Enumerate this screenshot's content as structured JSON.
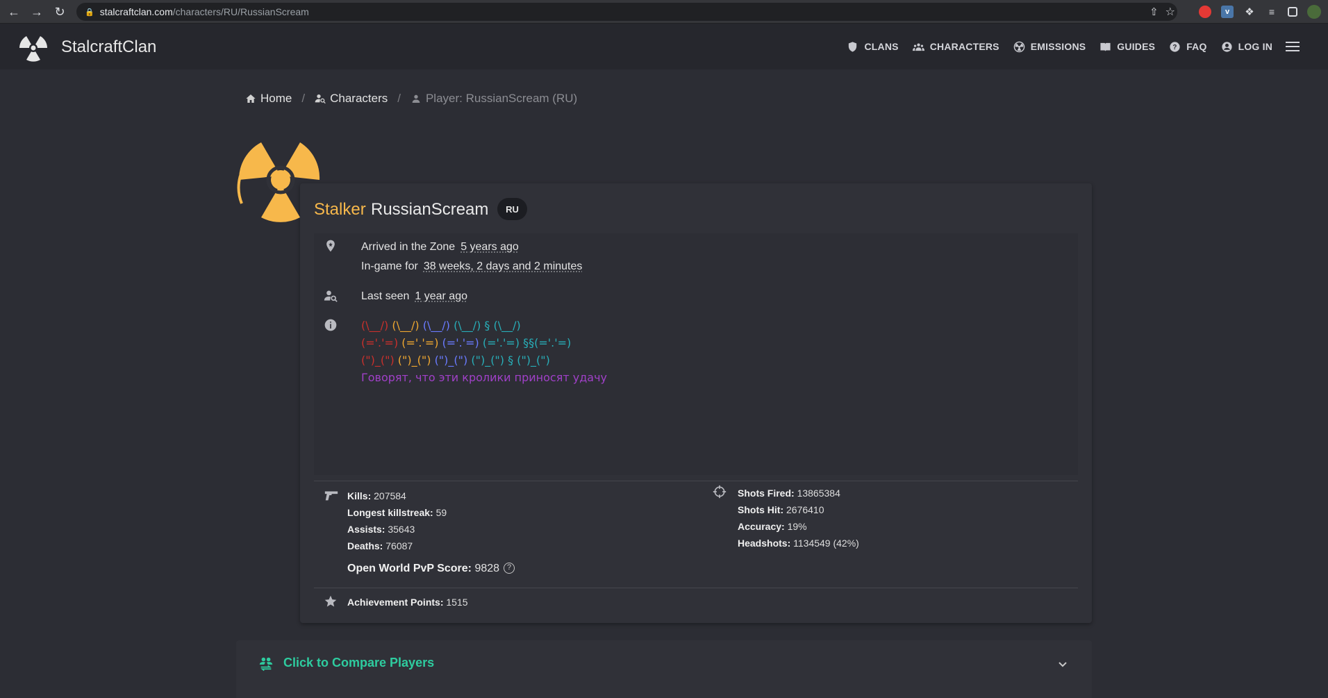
{
  "browser": {
    "url_host": "stalcraftclan.com",
    "url_path": "/characters/RU/RussianScream"
  },
  "site": {
    "brand": "StalcraftClan",
    "nav": [
      {
        "label": "CLANS",
        "icon": "shield-icon"
      },
      {
        "label": "CHARACTERS",
        "icon": "group-icon"
      },
      {
        "label": "EMISSIONS",
        "icon": "radiation-alert-icon"
      },
      {
        "label": "GUIDES",
        "icon": "book-icon"
      },
      {
        "label": "FAQ",
        "icon": "help-circle-icon"
      },
      {
        "label": "LOG IN",
        "icon": "account-circle-icon"
      }
    ]
  },
  "breadcrumb": {
    "home": "Home",
    "characters": "Characters",
    "current": "Player: RussianScream (RU)",
    "separator": "/"
  },
  "player": {
    "rank": "Stalker",
    "name": "RussianScream",
    "region": "RU",
    "arrived_label": "Arrived in the Zone",
    "arrived_value": "5 years ago",
    "ingame_label": "In-game for",
    "ingame_value": "38 weeks, 2 days and 2 minutes",
    "lastseen_label": "Last seen",
    "lastseen_value": "1 year ago",
    "bio": {
      "line1": [
        "(\\__/)",
        "(\\__/)",
        "(\\__/)",
        "(\\__/) § (\\__/)"
      ],
      "line2": [
        "(='.'=)",
        "(='.'=)",
        "(='.'=)",
        "(='.'=) §§(='.'=)"
      ],
      "line3": [
        "(\")_(\")",
        "(\")_(\")",
        "(\")_(\")",
        "(\")_(\") § (\")_(\")"
      ],
      "line4": "Говорят, что эти кролики приносят удачу"
    }
  },
  "stats": {
    "kills_label": "Kills:",
    "kills": "207584",
    "killstreak_label": "Longest killstreak:",
    "killstreak": "59",
    "assists_label": "Assists:",
    "assists": "35643",
    "deaths_label": "Deaths:",
    "deaths": "76087",
    "shots_fired_label": "Shots Fired:",
    "shots_fired": "13865384",
    "shots_hit_label": "Shots Hit:",
    "shots_hit": "2676410",
    "accuracy_label": "Accuracy:",
    "accuracy": "19%",
    "headshots_label": "Headshots:",
    "headshots": "1134549 (42%)",
    "pvp_label": "Open World PvP Score:",
    "pvp": "9828",
    "achievement_label": "Achievement Points:",
    "achievement": "1515"
  },
  "compare": {
    "label": "Click to Compare Players"
  },
  "colors": {
    "accent_gold": "#f7b84b",
    "compare_green": "#2ecc9f",
    "bio_red": "#c9302c",
    "bio_orange": "#f0a830",
    "bio_blue": "#6a7bff",
    "bio_teal": "#28aeb8",
    "bio_purple": "#a040c8"
  }
}
